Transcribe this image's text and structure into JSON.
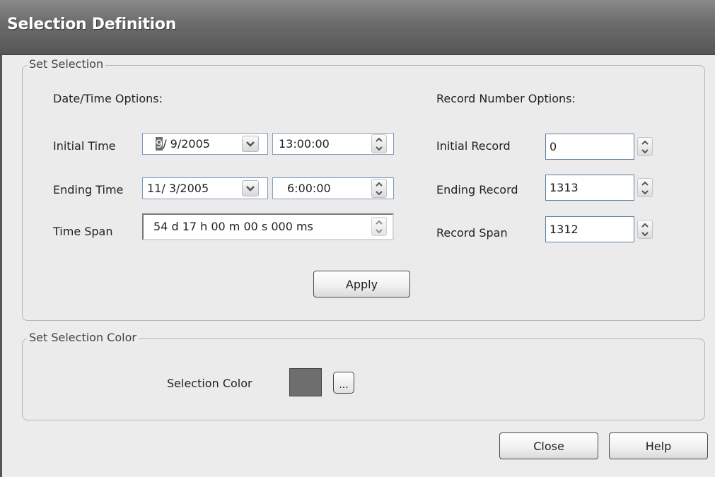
{
  "window": {
    "title": "Selection Definition"
  },
  "set_selection": {
    "legend": "Set Selection",
    "datetime_heading": "Date/Time Options:",
    "record_heading": "Record Number Options:",
    "initial_time": {
      "label": "Initial Time",
      "date_selected": "9",
      "date_rest": "/ 9/2005",
      "time": "13:00:00"
    },
    "ending_time": {
      "label": "Ending Time",
      "date": "11/ 3/2005",
      "time": "6:00:00"
    },
    "time_span": {
      "label": "Time Span",
      "value": "54 d 17 h 00 m 00 s 000 ms"
    },
    "initial_record": {
      "label": "Initial Record",
      "value": "0"
    },
    "ending_record": {
      "label": "Ending Record",
      "value": "1313"
    },
    "record_span": {
      "label": "Record Span",
      "value": "1312"
    },
    "apply_label": "Apply"
  },
  "set_selection_color": {
    "legend": "Set Selection Color",
    "color_label": "Selection Color",
    "color": "#6e6e6e",
    "browse_label": "..."
  },
  "footer": {
    "close_label": "Close",
    "help_label": "Help"
  }
}
